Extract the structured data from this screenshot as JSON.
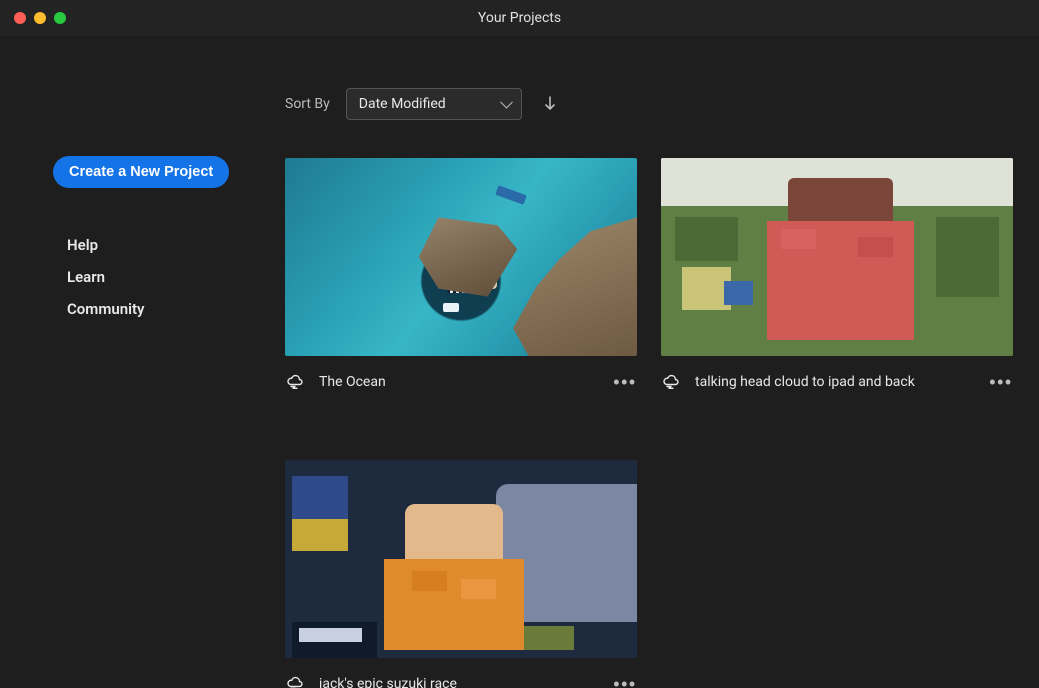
{
  "window": {
    "title": "Your Projects"
  },
  "sidebar": {
    "new_project_label": "Create a New Project",
    "links": [
      {
        "label": "Help"
      },
      {
        "label": "Learn"
      },
      {
        "label": "Community"
      }
    ]
  },
  "sort": {
    "label": "Sort By",
    "selected": "Date Modified",
    "direction": "descending"
  },
  "projects": [
    {
      "title": "The Ocean",
      "thumb": "ocean"
    },
    {
      "title": "talking head cloud to ipad and back",
      "thumb": "talking"
    },
    {
      "title": "jack's epic suzuki race",
      "thumb": "jack"
    }
  ],
  "colors": {
    "accent": "#1473e6",
    "bg": "#1e1e1e",
    "titlebar": "#232323"
  }
}
